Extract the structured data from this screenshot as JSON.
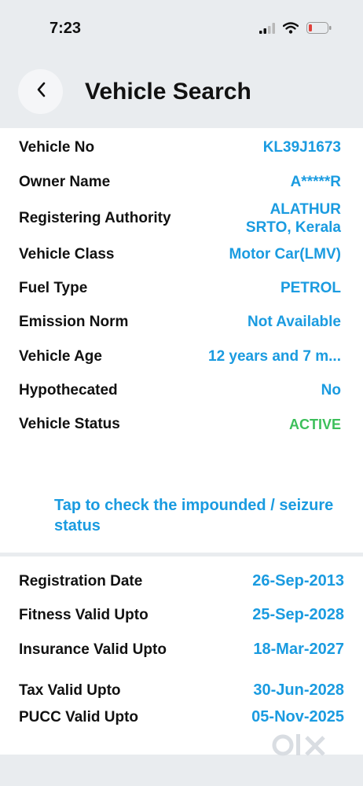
{
  "status_bar": {
    "time": "7:23",
    "icons": [
      "signal-icon",
      "wifi-icon",
      "battery-icon"
    ],
    "battery_color": "#e0413b"
  },
  "header": {
    "title": "Vehicle Search",
    "back_icon": "chevron-left-icon"
  },
  "details": [
    {
      "label": "Vehicle No",
      "value": "KL39J1673"
    },
    {
      "label": "Owner Name",
      "value": "A*****R"
    },
    {
      "label": "Registering Authority",
      "value": "ALATHUR\nSRTO, Kerala"
    },
    {
      "label": "Vehicle Class",
      "value": "Motor Car(LMV)"
    },
    {
      "label": "Fuel Type",
      "value": "PETROL"
    },
    {
      "label": "Emission Norm",
      "value": "Not Available"
    },
    {
      "label": "Vehicle Age",
      "value": "12 years and 7 m..."
    },
    {
      "label": "Hypothecated",
      "value": "No"
    },
    {
      "label": "Vehicle Status",
      "value": "ACTIVE"
    }
  ],
  "impound_link": "Tap to check the impounded / seizure status",
  "validity": [
    {
      "label": "Registration Date",
      "value": "26-Sep-2013"
    },
    {
      "label": "Fitness Valid Upto",
      "value": "25-Sep-2028"
    },
    {
      "label": "Insurance Valid Upto",
      "value": "18-Mar-2027"
    },
    {
      "label": "Tax Valid Upto",
      "value": "30-Jun-2028"
    },
    {
      "label": "PUCC Valid Upto",
      "value": "05-Nov-2025"
    }
  ],
  "watermark": "OLX",
  "colors": {
    "accent": "#1a9be0",
    "active": "#3cbf5a",
    "background": "#e9ecef"
  }
}
